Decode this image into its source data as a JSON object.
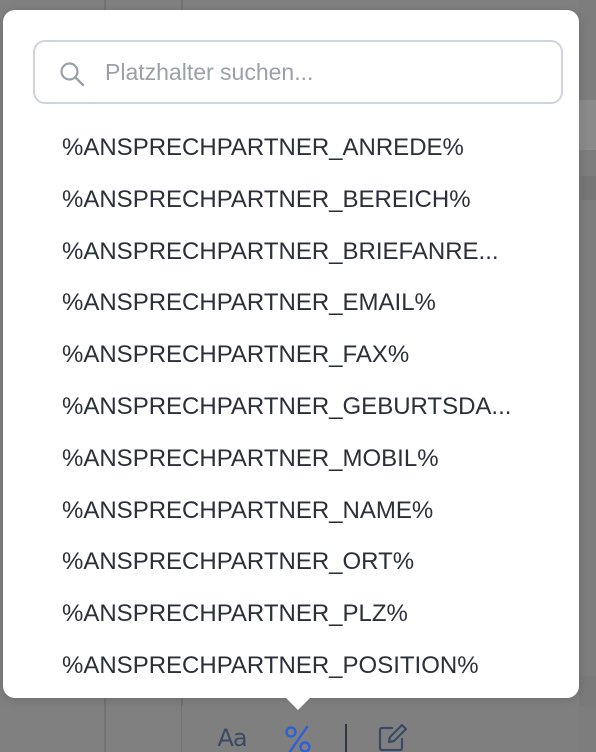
{
  "search": {
    "placeholder": "Platzhalter suchen...",
    "value": ""
  },
  "placeholders": [
    "%ANSPRECHPARTNER_ANREDE%",
    "%ANSPRECHPARTNER_BEREICH%",
    "%ANSPRECHPARTNER_BRIEFANRE...",
    "%ANSPRECHPARTNER_EMAIL%",
    "%ANSPRECHPARTNER_FAX%",
    "%ANSPRECHPARTNER_GEBURTSDA...",
    "%ANSPRECHPARTNER_MOBIL%",
    "%ANSPRECHPARTNER_NAME%",
    "%ANSPRECHPARTNER_ORT%",
    "%ANSPRECHPARTNER_PLZ%",
    "%ANSPRECHPARTNER_POSITION%"
  ],
  "toolbar": {
    "text_format_label": "Aa",
    "text_format_icon": "text-format-icon",
    "placeholder_icon": "percent-icon",
    "edit_icon": "edit-icon"
  },
  "colors": {
    "accent": "#2f5fd6",
    "toolbar_icon": "#3a4a66",
    "overlay": "#808080"
  }
}
